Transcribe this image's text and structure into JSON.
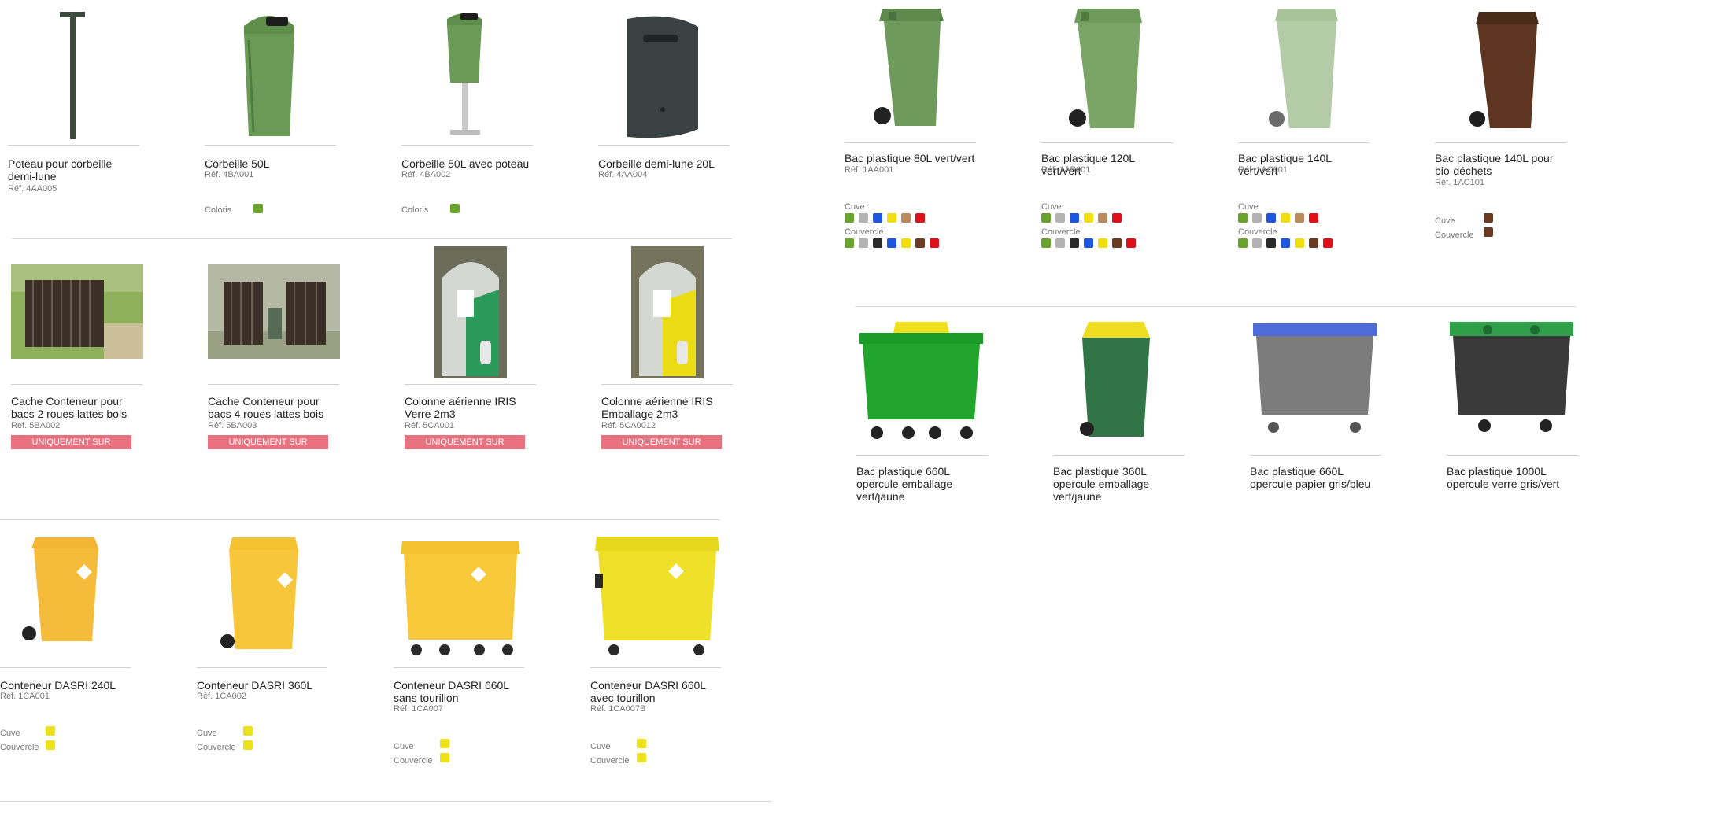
{
  "labels": {
    "coloris": "Coloris",
    "cuve": "Cuve",
    "couvercle": "Couvercle",
    "on_demand": "UNIQUEMENT SUR DEMANDE"
  },
  "colors": {
    "green": "#6aa22e",
    "lightgray": "#b3b3b3",
    "blue": "#1f56e0",
    "yellow": "#f1de0f",
    "tan": "#b88a5c",
    "red": "#e0101b",
    "black": "#2a2a2a",
    "brown": "#6b3a22",
    "dasri_yellow": "#ece21b"
  },
  "products": {
    "p1": {
      "title": "Poteau pour corbeille demi-lune",
      "ref": "Réf. 4AA005"
    },
    "p2": {
      "title": "Corbeille 50L",
      "ref": "Réf. 4BA001"
    },
    "p3": {
      "title": "Corbeille 50L avec poteau",
      "ref": "Réf. 4BA002"
    },
    "p4": {
      "title": "Corbeille demi-lune 20L",
      "ref": "Réf. 4AA004"
    },
    "p5": {
      "title": "Cache Conteneur pour bacs 2 roues lattes bois",
      "ref": "Réf. 5BA002"
    },
    "p6": {
      "title": "Cache Conteneur pour bacs 4 roues lattes bois",
      "ref": "Réf. 5BA003"
    },
    "p7": {
      "title": "Colonne aérienne IRIS Verre 2m3",
      "ref": "Réf. 5CA001"
    },
    "p8": {
      "title": "Colonne aérienne IRIS Emballage 2m3",
      "ref": "Réf. 5CA0012"
    },
    "p9": {
      "title": "Conteneur DASRI 240L",
      "ref": "Réf. 1CA001"
    },
    "p10": {
      "title": "Conteneur DASRI 360L",
      "ref": "Réf. 1CA002"
    },
    "p11": {
      "title": "Conteneur DASRI 660L sans tourillon",
      "ref": "Réf. 1CA007"
    },
    "p12": {
      "title": "Conteneur DASRI 660L avec tourillon",
      "ref": "Réf. 1CA007B"
    },
    "p13": {
      "title": "Bac plastique 80L vert/vert",
      "ref": "Réf. 1AA001"
    },
    "p14": {
      "title": "Bac plastique 120L vert/vert",
      "ref": "Réf. 1AB001"
    },
    "p15": {
      "title": "Bac plastique 140L vert/vert",
      "ref": "Réf. 1AC001"
    },
    "p16": {
      "title": "Bac plastique 140L pour bio-déchets",
      "ref": "Réf. 1AC101"
    },
    "p17": {
      "title": "Bac plastique 660L opercule emballage vert/jaune"
    },
    "p18": {
      "title": "Bac plastique 360L opercule emballage vert/jaune"
    },
    "p19": {
      "title": "Bac plastique 660L opercule papier gris/bleu"
    },
    "p20": {
      "title": "Bac plastique 1000L opercule verre gris/vert"
    }
  }
}
